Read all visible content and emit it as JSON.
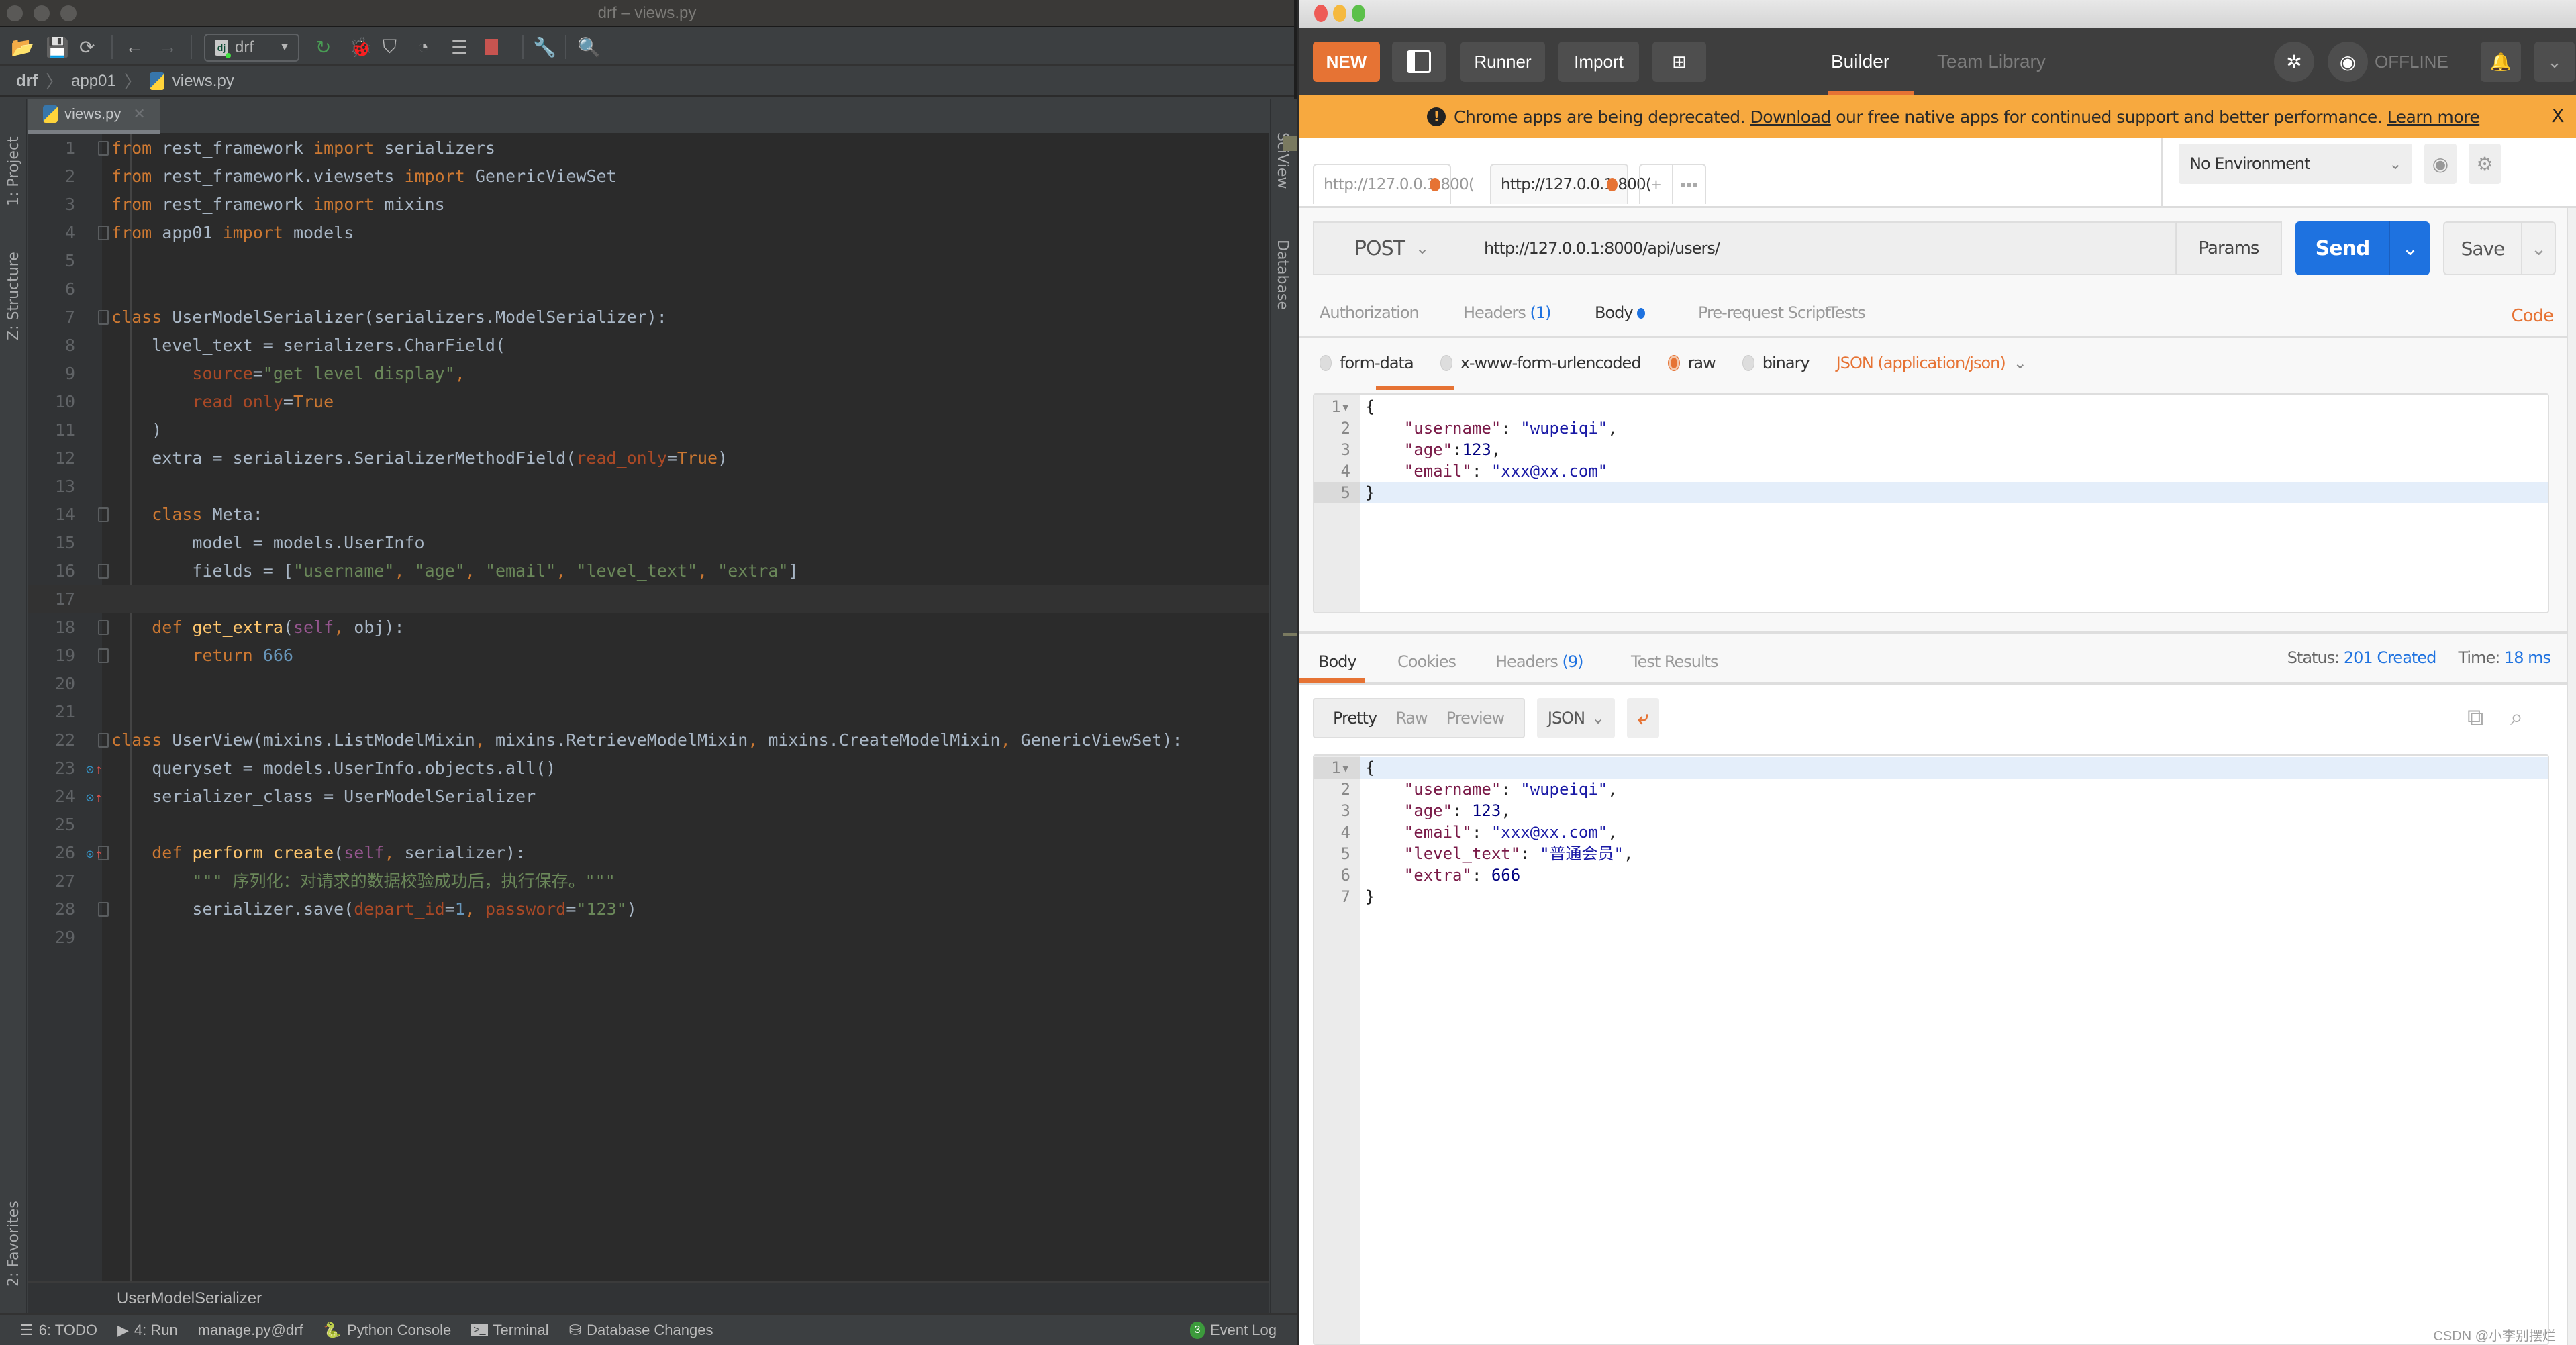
{
  "ide": {
    "window_title": "drf – views.py",
    "run_config": "drf",
    "breadcrumb": [
      "drf",
      "app01",
      "views.py"
    ],
    "left_tool_tabs": [
      "1: Project",
      "Z: Structure",
      "2: Favorites"
    ],
    "right_tool_tabs": [
      "SciView",
      "Database"
    ],
    "editor_tab": "views.py",
    "code_lines": [
      [
        {
          "t": "from",
          "c": "k"
        },
        {
          "t": " rest_framework "
        },
        {
          "t": "import",
          "c": "k"
        },
        {
          "t": " serializers"
        }
      ],
      [
        {
          "t": "from",
          "c": "k"
        },
        {
          "t": " rest_framework.viewsets "
        },
        {
          "t": "import",
          "c": "k"
        },
        {
          "t": " GenericViewSet"
        }
      ],
      [
        {
          "t": "from",
          "c": "k"
        },
        {
          "t": " rest_framework "
        },
        {
          "t": "import",
          "c": "k"
        },
        {
          "t": " mixins"
        }
      ],
      [
        {
          "t": "from",
          "c": "k"
        },
        {
          "t": " app01 "
        },
        {
          "t": "import",
          "c": "k"
        },
        {
          "t": " models"
        }
      ],
      [],
      [],
      [
        {
          "t": "class",
          "c": "k"
        },
        {
          "t": " UserModelSerializer(serializers.ModelSerializer):"
        }
      ],
      [
        {
          "t": "    level_text = serializers.CharField("
        }
      ],
      [
        {
          "t": "        "
        },
        {
          "t": "source",
          "c": "p"
        },
        {
          "t": "="
        },
        {
          "t": "\"get_level_display\"",
          "c": "s"
        },
        {
          "t": ",",
          "c": "k"
        }
      ],
      [
        {
          "t": "        "
        },
        {
          "t": "read_only",
          "c": "p"
        },
        {
          "t": "="
        },
        {
          "t": "True",
          "c": "k"
        }
      ],
      [
        {
          "t": "    )"
        }
      ],
      [
        {
          "t": "    extra = serializers.SerializerMethodField("
        },
        {
          "t": "read_only",
          "c": "p"
        },
        {
          "t": "="
        },
        {
          "t": "True",
          "c": "k"
        },
        {
          "t": ")"
        }
      ],
      [],
      [
        {
          "t": "    "
        },
        {
          "t": "class",
          "c": "k"
        },
        {
          "t": " Meta:"
        }
      ],
      [
        {
          "t": "        model = models.UserInfo"
        }
      ],
      [
        {
          "t": "        fields = ["
        },
        {
          "t": "\"username\"",
          "c": "s"
        },
        {
          "t": ", ",
          "c": "k"
        },
        {
          "t": "\"age\"",
          "c": "s"
        },
        {
          "t": ", ",
          "c": "k"
        },
        {
          "t": "\"email\"",
          "c": "s"
        },
        {
          "t": ", ",
          "c": "k"
        },
        {
          "t": "\"level_text\"",
          "c": "s"
        },
        {
          "t": ", ",
          "c": "k"
        },
        {
          "t": "\"extra\"",
          "c": "s"
        },
        {
          "t": "]"
        }
      ],
      [],
      [
        {
          "t": "    "
        },
        {
          "t": "def",
          "c": "k"
        },
        {
          "t": " "
        },
        {
          "t": "get_extra",
          "c": "fn"
        },
        {
          "t": "("
        },
        {
          "t": "self",
          "c": "sf"
        },
        {
          "t": ", ",
          "c": "k"
        },
        {
          "t": "obj):"
        }
      ],
      [
        {
          "t": "        "
        },
        {
          "t": "return",
          "c": "k"
        },
        {
          "t": " "
        },
        {
          "t": "666",
          "c": "n"
        }
      ],
      [],
      [],
      [
        {
          "t": "class",
          "c": "k"
        },
        {
          "t": " UserView(mixins.ListModelMixin"
        },
        {
          "t": ", ",
          "c": "k"
        },
        {
          "t": "mixins.RetrieveModelMixin"
        },
        {
          "t": ", ",
          "c": "k"
        },
        {
          "t": "mixins.CreateModelMixin"
        },
        {
          "t": ", ",
          "c": "k"
        },
        {
          "t": "GenericViewSet):"
        }
      ],
      [
        {
          "t": "    queryset = models.UserInfo.objects.all()"
        }
      ],
      [
        {
          "t": "    serializer_class = UserModelSerializer"
        }
      ],
      [],
      [
        {
          "t": "    "
        },
        {
          "t": "def",
          "c": "k"
        },
        {
          "t": " "
        },
        {
          "t": "perform_create",
          "c": "fn"
        },
        {
          "t": "("
        },
        {
          "t": "self",
          "c": "sf"
        },
        {
          "t": ", ",
          "c": "k"
        },
        {
          "t": "serializer):"
        }
      ],
      [
        {
          "t": "        "
        },
        {
          "t": "\"\"\" 序列化：对请求的数据校验成功后，执行保存。\"\"\"",
          "c": "s"
        }
      ],
      [
        {
          "t": "        serializer.save("
        },
        {
          "t": "depart_id",
          "c": "p"
        },
        {
          "t": "="
        },
        {
          "t": "1",
          "c": "n"
        },
        {
          "t": ", ",
          "c": "k"
        },
        {
          "t": "password",
          "c": "p"
        },
        {
          "t": "="
        },
        {
          "t": "\"123\"",
          "c": "s"
        },
        {
          "t": ")"
        }
      ],
      []
    ],
    "current_line": 17,
    "structure_breadcrumb": "UserModelSerializer",
    "statusbar": {
      "todo": "6: TODO",
      "run": "4: Run",
      "manage": "manage.py@drf",
      "python_console": "Python Console",
      "terminal": "Terminal",
      "db_changes": "Database Changes",
      "event_log": "Event Log",
      "event_count": "3"
    }
  },
  "postman": {
    "header": {
      "new_label": "NEW",
      "runner_label": "Runner",
      "import_label": "Import",
      "builder_label": "Builder",
      "team_library_label": "Team Library",
      "offline_label": "OFFLINE"
    },
    "banner": {
      "text_before": "Chrome apps are being deprecated. ",
      "download_link": "Download",
      "text_after": " our free native apps for continued support and better performance. ",
      "learn_more_link": "Learn more",
      "close": "X"
    },
    "request_tabs": [
      {
        "label": "http://127.0.0.1:800(",
        "active": false
      },
      {
        "label": "http://127.0.0.1:800(",
        "active": true
      }
    ],
    "environment": "No Environment",
    "request": {
      "method": "POST",
      "url": "http://127.0.0.1:8000/api/users/",
      "params_label": "Params",
      "send_label": "Send",
      "save_label": "Save",
      "subtabs": {
        "authorization": "Authorization",
        "headers": "Headers",
        "headers_count": "(1)",
        "body": "Body",
        "prerequest": "Pre-request Script",
        "tests": "Tests"
      },
      "code_link": "Code",
      "body_types": [
        "form-data",
        "x-www-form-urlencoded",
        "raw",
        "binary"
      ],
      "selected_body_type": "raw",
      "content_type": "JSON (application/json)",
      "body_lines": [
        [
          {
            "t": "{"
          }
        ],
        [
          {
            "t": "    "
          },
          {
            "t": "\"username\"",
            "c": "jk"
          },
          {
            "t": ": "
          },
          {
            "t": "\"wupeiqi\"",
            "c": "js"
          },
          {
            "t": ","
          }
        ],
        [
          {
            "t": "    "
          },
          {
            "t": "\"age\"",
            "c": "jk"
          },
          {
            "t": ":"
          },
          {
            "t": "123",
            "c": "jn"
          },
          {
            "t": ","
          }
        ],
        [
          {
            "t": "    "
          },
          {
            "t": "\"email\"",
            "c": "jk"
          },
          {
            "t": ": "
          },
          {
            "t": "\"xxx@xx.com\"",
            "c": "js"
          }
        ],
        [
          {
            "t": "}"
          }
        ]
      ]
    },
    "response": {
      "tabs": {
        "body": "Body",
        "cookies": "Cookies",
        "headers": "Headers",
        "headers_count": "(9)",
        "test_results": "Test Results"
      },
      "status_label": "Status:",
      "status_value": "201 Created",
      "time_label": "Time:",
      "time_value": "18 ms",
      "view_modes": [
        "Pretty",
        "Raw",
        "Preview"
      ],
      "format": "JSON",
      "body_lines": [
        [
          {
            "t": "{"
          }
        ],
        [
          {
            "t": "    "
          },
          {
            "t": "\"username\"",
            "c": "jk"
          },
          {
            "t": ": "
          },
          {
            "t": "\"wupeiqi\"",
            "c": "js"
          },
          {
            "t": ","
          }
        ],
        [
          {
            "t": "    "
          },
          {
            "t": "\"age\"",
            "c": "jk"
          },
          {
            "t": ": "
          },
          {
            "t": "123",
            "c": "jn"
          },
          {
            "t": ","
          }
        ],
        [
          {
            "t": "    "
          },
          {
            "t": "\"email\"",
            "c": "jk"
          },
          {
            "t": ": "
          },
          {
            "t": "\"xxx@xx.com\"",
            "c": "js"
          },
          {
            "t": ","
          }
        ],
        [
          {
            "t": "    "
          },
          {
            "t": "\"level_text\"",
            "c": "jk"
          },
          {
            "t": ": "
          },
          {
            "t": "\"普通会员\"",
            "c": "js"
          },
          {
            "t": ","
          }
        ],
        [
          {
            "t": "    "
          },
          {
            "t": "\"extra\"",
            "c": "jk"
          },
          {
            "t": ": "
          },
          {
            "t": "666",
            "c": "jn"
          }
        ],
        [
          {
            "t": "}"
          }
        ]
      ]
    },
    "watermark": "CSDN @小李别摆烂"
  }
}
